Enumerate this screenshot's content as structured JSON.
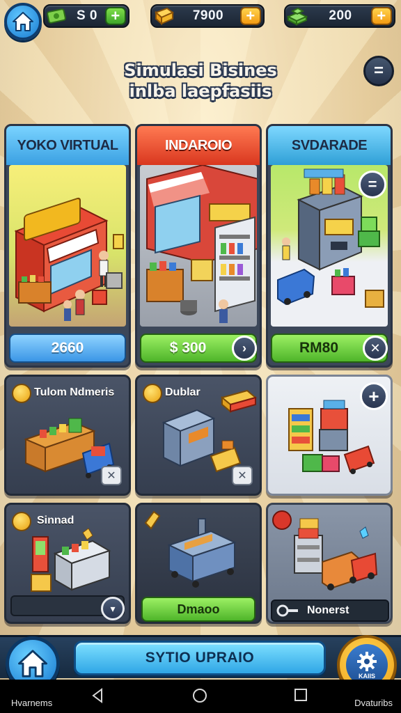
{
  "resources": [
    {
      "name": "cash",
      "value": "S 0",
      "plus": "+"
    },
    {
      "name": "gold",
      "value": "7900",
      "plus": "+"
    },
    {
      "name": "gems",
      "value": "200",
      "plus": "+"
    }
  ],
  "title": {
    "line1": "Simulasi Bisines",
    "line2": "inlba laepfasiis"
  },
  "menu_button": "=",
  "businesses": [
    {
      "name": "YOKO VIRTUAL",
      "sign": "",
      "price": "2660",
      "action": ""
    },
    {
      "name": "INDAROIO",
      "sign": "",
      "price": "$ 300",
      "action": "›"
    },
    {
      "name": "SVDARADE",
      "sign": "",
      "price": "RM80",
      "action": "✕"
    }
  ],
  "tiles": [
    {
      "label": "Tulom Ndmeris",
      "tool": "✕"
    },
    {
      "label": "Dublar",
      "tool": "✕"
    },
    {
      "label": "",
      "tool": "+"
    },
    {
      "label": "Sinnad",
      "tool": "▾"
    },
    {
      "label": "",
      "button": "Dmaoo"
    },
    {
      "label": "Nonerst",
      "tool": ""
    }
  ],
  "bottom": {
    "upgrade_label": "SYTIO UPRAIO",
    "gear_label": "KAIIS",
    "home_label": "Hvarnems",
    "right_label": "Dvaturibs"
  },
  "colors": {
    "blue_header": "#4fb8ee",
    "red_header": "#e24a2e",
    "teal_header": "#3aa9d6",
    "price_blue": "#3b9fe8",
    "price_green": "#6fcf3a"
  }
}
